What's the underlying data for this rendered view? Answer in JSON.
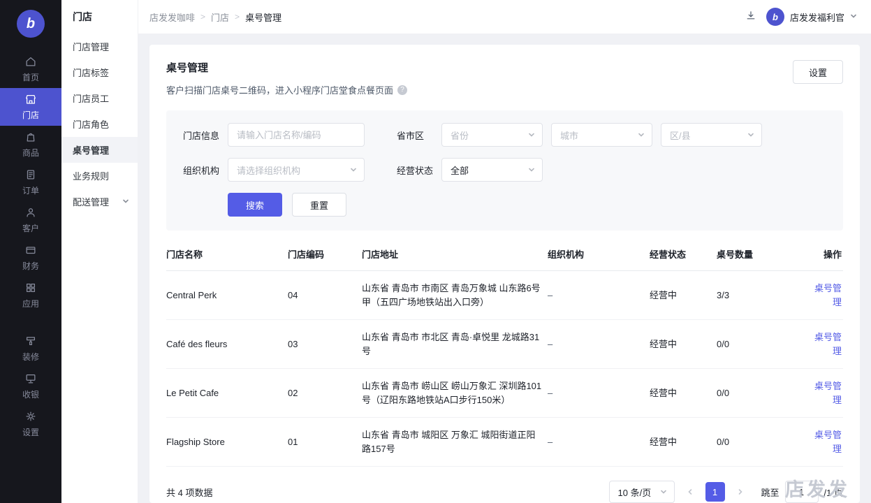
{
  "colors": {
    "primary": "#545CE6",
    "link": "#545CE6",
    "sidebar_bg": "#16171D",
    "sidebar_active": "#4D53CF",
    "main_bg": "#F0F1F5",
    "filter_bg": "#F7F8FA",
    "text": "#1D2129",
    "watermark": "#C5C9D2"
  },
  "app": {
    "logo_glyph": "b",
    "watermark": "店发发"
  },
  "sidebar": {
    "items": [
      {
        "label": "首页"
      },
      {
        "label": "门店"
      },
      {
        "label": "商品"
      },
      {
        "label": "订单"
      },
      {
        "label": "客户"
      },
      {
        "label": "财务"
      },
      {
        "label": "应用"
      },
      {
        "label": "装修"
      },
      {
        "label": "收银"
      },
      {
        "label": "设置"
      }
    ]
  },
  "submenu": {
    "title": "门店",
    "items": [
      {
        "label": "门店管理"
      },
      {
        "label": "门店标签"
      },
      {
        "label": "门店员工"
      },
      {
        "label": "门店角色"
      },
      {
        "label": "桌号管理"
      },
      {
        "label": "业务规则"
      },
      {
        "label": "配送管理"
      }
    ]
  },
  "header": {
    "breadcrumb": [
      "店发发咖啡",
      "门店",
      "桌号管理"
    ],
    "separator": ">",
    "user_name": "店发发福利官"
  },
  "page": {
    "title": "桌号管理",
    "subtitle": "客户扫描门店桌号二维码，进入小程序门店堂食点餐页面",
    "settings_button": "设置"
  },
  "filters": {
    "store_info_label": "门店信息",
    "store_info_placeholder": "请输入门店名称/编码",
    "region_label": "省市区",
    "province_placeholder": "省份",
    "city_placeholder": "城市",
    "district_placeholder": "区/县",
    "org_label": "组织机构",
    "org_placeholder": "请选择组织机构",
    "status_label": "经营状态",
    "status_value": "全部",
    "search_button": "搜索",
    "reset_button": "重置"
  },
  "table": {
    "columns": [
      "门店名称",
      "门店编码",
      "门店地址",
      "组织机构",
      "经营状态",
      "桌号数量",
      "操作"
    ],
    "rows": [
      {
        "name": "Central Perk",
        "code": "04",
        "address": "山东省 青岛市 市南区 青岛万象城 山东路6号甲（五四广场地铁站出入口旁）",
        "org": "–",
        "status": "经营中",
        "count": "3/3",
        "action": "桌号管理"
      },
      {
        "name": "Café des fleurs",
        "code": "03",
        "address": "山东省 青岛市 市北区 青岛·卓悦里 龙城路31号",
        "org": "–",
        "status": "经营中",
        "count": "0/0",
        "action": "桌号管理"
      },
      {
        "name": "Le Petit Cafe",
        "code": "02",
        "address": "山东省 青岛市 崂山区 崂山万象汇 深圳路101号（辽阳东路地铁站A口步行150米）",
        "org": "–",
        "status": "经营中",
        "count": "0/0",
        "action": "桌号管理"
      },
      {
        "name": "Flagship Store",
        "code": "01",
        "address": "山东省 青岛市 城阳区 万象汇 城阳街道正阳路157号",
        "org": "–",
        "status": "经营中",
        "count": "0/0",
        "action": "桌号管理"
      }
    ]
  },
  "pagination": {
    "total_text": "共 4 项数据",
    "page_size": "10 条/页",
    "current_page": "1",
    "jump_label": "跳至",
    "jump_value": "1",
    "page_suffix": "/1 页"
  }
}
